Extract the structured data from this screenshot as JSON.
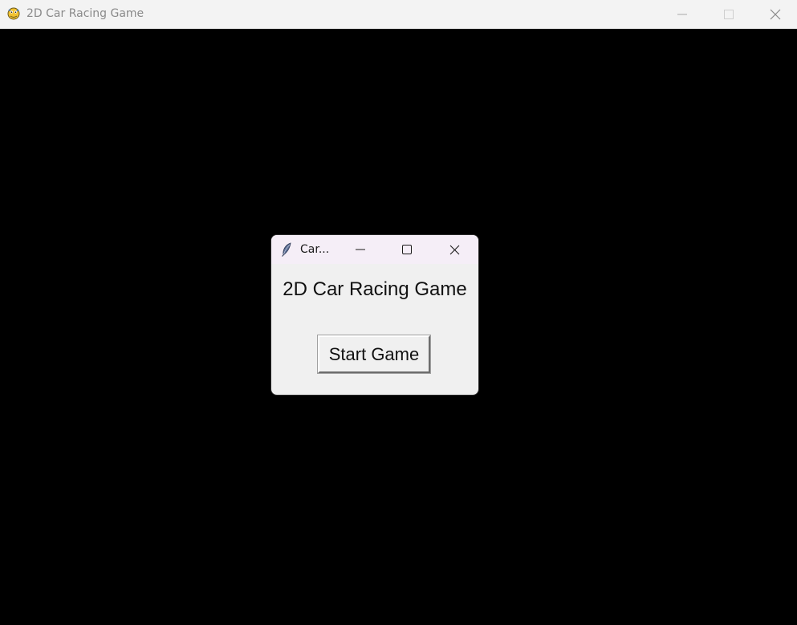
{
  "main_window": {
    "title": "2D Car Racing Game",
    "icon": "pygame-snake-icon",
    "controls": {
      "minimize": "minimize-icon",
      "maximize": "maximize-icon",
      "close": "close-icon"
    },
    "background_color": "#000000"
  },
  "dialog": {
    "title": "Car...",
    "icon": "feather-icon",
    "heading": "2D Car Racing Game",
    "start_button_label": "Start Game",
    "controls": {
      "minimize": "minimize-icon",
      "maximize": "maximize-icon",
      "close": "close-icon"
    }
  }
}
